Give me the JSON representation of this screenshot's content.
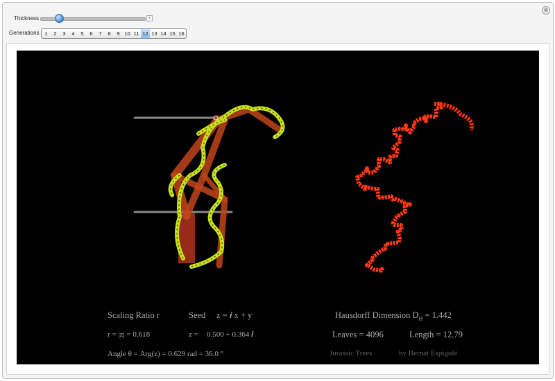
{
  "controls": {
    "thickness_label": "Thickness",
    "thickness_value": 0.17,
    "plus_symbol": "+",
    "generations_label": "Generations",
    "generations": [
      "1",
      "2",
      "3",
      "4",
      "5",
      "6",
      "7",
      "8",
      "9",
      "10",
      "11",
      "12",
      "13",
      "14",
      "15",
      "16"
    ],
    "selected_generation": "12",
    "close_symbol": "⊗"
  },
  "info": {
    "scaling_ratio": "Scaling Ratio r",
    "seed_label": "Seed",
    "seed_formula": "z = 𝒊 x + y",
    "r_value": "r = |z| = 0.618",
    "z_label": "z =",
    "z_value": "0.500 + 0.364 𝒊",
    "angle": "Angle   θ = Arg(z) = 0.629 rad = 36.0 °",
    "hausdorff": "Hausdorff Dimension D",
    "hausdorff_sub": "H",
    "hausdorff_value": " = 1.442",
    "leaves": "Leaves = 4096",
    "length": "Length = 12.79",
    "title": "Jurassic Trees",
    "author": "by Bernat Espigulé"
  },
  "colors": {
    "canvas_bg": "#000000",
    "branch": "#c1441b",
    "leaf_yellow": "#c8e01c",
    "fractal_red": "#ff3010"
  }
}
